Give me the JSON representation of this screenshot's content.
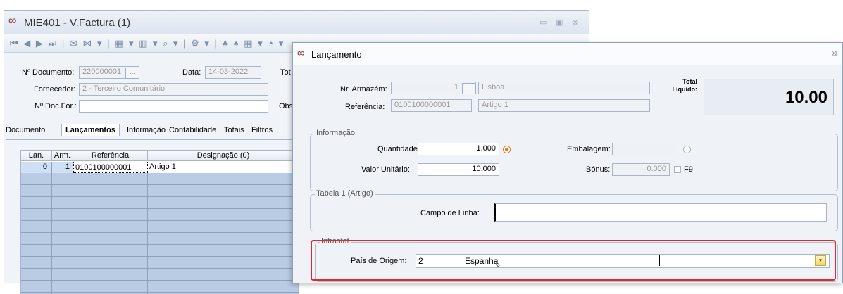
{
  "back_window": {
    "title": "MIE401 - V.Factura (1)",
    "toolbar_glyphs": "⏮ ◀ ▶ ⏭ | ✉ ⋈ ▾ | ▦ ▾ ▥ ▾ ⌕ ▾ | ⚙ ▾ | ♣ ♠ ▦ ▾ ◔ ▾",
    "form": {
      "doc_label": "Nº Documento:",
      "doc_value": "220000001",
      "date_label": "Data:",
      "date_value": "14-03-2022",
      "total_label_cut": "Tot",
      "supplier_label": "Fornecedor:",
      "supplier_value": "2 - Terceiro Comunitário",
      "docfor_label": "Nº Doc.For.:",
      "docfor_value": "",
      "obs_label_cut": "Obs"
    },
    "tabs": [
      "Documento",
      "Lançamentos",
      "Informação",
      "Contabilidade",
      "Totais",
      "Filtros"
    ],
    "active_tab": "Lançamentos",
    "grid": {
      "headers": [
        "Lan.",
        "Arm.",
        "Referência",
        "Designação (0)"
      ],
      "rows": [
        {
          "lan": "0",
          "arm": "1",
          "ref": "0100100000001",
          "desig": "Artigo 1"
        }
      ]
    }
  },
  "dialog": {
    "title": "Lançamento",
    "close_glyph": "⊠",
    "armazem_label": "Nr. Armazém:",
    "armazem_value": "1",
    "armazem_name": "Lisboa",
    "referencia_label": "Referência:",
    "referencia_value": "0100100000001",
    "referencia_name": "Artigo 1",
    "total_label_1": "Total",
    "total_label_2": "Líquido:",
    "total_value": "10.00",
    "info_group": "Informação",
    "quantidade_label": "Quantidade:",
    "quantidade_value": "1.000",
    "embalagem_label": "Embalagem:",
    "embalagem_value": "",
    "valor_label": "Valor Unitário:",
    "valor_value": "10.000",
    "bonus_label": "Bónus:",
    "bonus_value": "0.000",
    "f9_label": "F9",
    "tabela_group": "Tabela 1 (Artigo)",
    "campo_label": "Campo de Linha:",
    "campo_value": "",
    "intrastat_group": "Intrastat",
    "pais_label": "País de Origem:",
    "pais_code": "2",
    "pais_name": "Espanha"
  }
}
